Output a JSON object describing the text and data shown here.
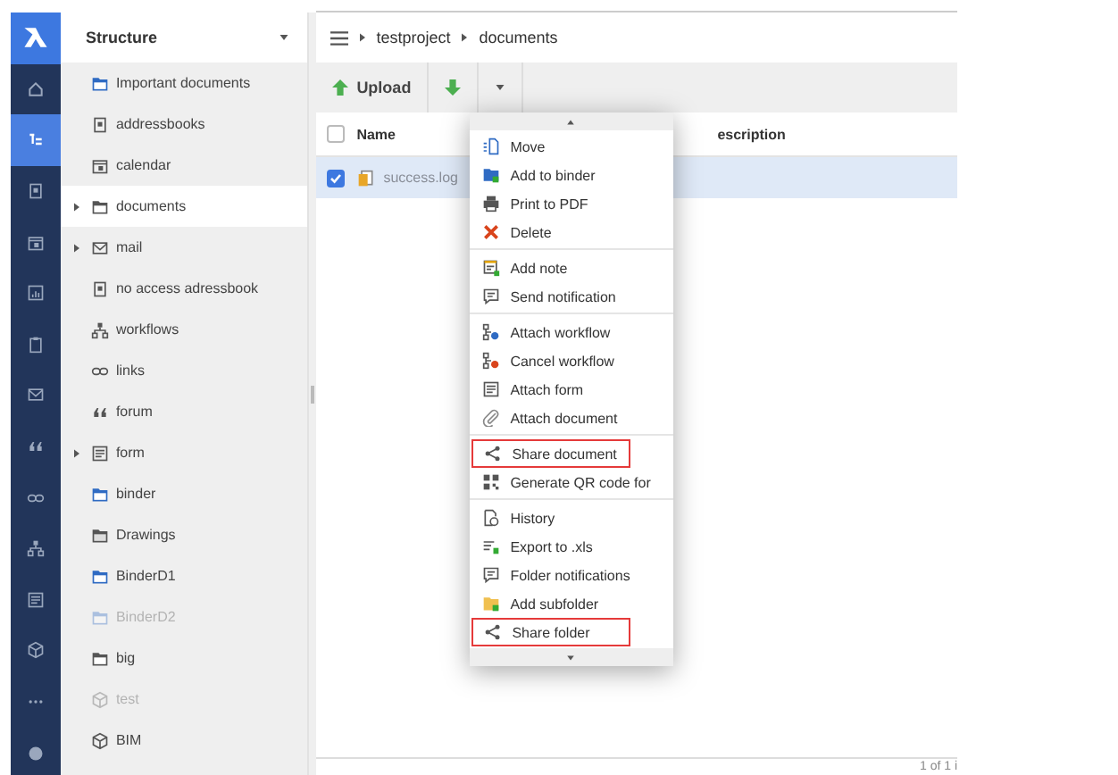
{
  "rail": [
    {
      "kind": "logo",
      "selected": false
    },
    {
      "kind": "home",
      "selected": false
    },
    {
      "kind": "tree",
      "selected": true
    },
    {
      "kind": "addressbook",
      "selected": false
    },
    {
      "kind": "calendar",
      "selected": false
    },
    {
      "kind": "chart",
      "selected": false
    },
    {
      "kind": "clipboard",
      "selected": false
    },
    {
      "kind": "mail",
      "selected": false
    },
    {
      "kind": "quote",
      "selected": false
    },
    {
      "kind": "link",
      "selected": false
    },
    {
      "kind": "workflow",
      "selected": false
    },
    {
      "kind": "form",
      "selected": false
    },
    {
      "kind": "cube",
      "selected": false
    },
    {
      "kind": "more",
      "selected": false
    },
    {
      "kind": "circle",
      "selected": false
    }
  ],
  "sidebar": {
    "title": "Structure",
    "items": [
      {
        "label": "Important documents",
        "kind": "folder-blue",
        "expandable": false,
        "selected": false,
        "disabled": false
      },
      {
        "label": "addressbooks",
        "kind": "addressbook",
        "expandable": false,
        "selected": false,
        "disabled": false
      },
      {
        "label": "calendar",
        "kind": "calendar",
        "expandable": false,
        "selected": false,
        "disabled": false
      },
      {
        "label": "documents",
        "kind": "folder",
        "expandable": true,
        "selected": true,
        "disabled": false
      },
      {
        "label": "mail",
        "kind": "mail",
        "expandable": true,
        "selected": false,
        "disabled": false
      },
      {
        "label": "no access adressbook",
        "kind": "addressbook",
        "expandable": false,
        "selected": false,
        "disabled": false
      },
      {
        "label": "workflows",
        "kind": "workflow",
        "expandable": false,
        "selected": false,
        "disabled": false
      },
      {
        "label": "links",
        "kind": "link",
        "expandable": false,
        "selected": false,
        "disabled": false
      },
      {
        "label": "forum",
        "kind": "quote",
        "expandable": false,
        "selected": false,
        "disabled": false
      },
      {
        "label": "form",
        "kind": "form",
        "expandable": true,
        "selected": false,
        "disabled": false
      },
      {
        "label": "binder",
        "kind": "folder-blue",
        "expandable": false,
        "selected": false,
        "disabled": false
      },
      {
        "label": "Drawings",
        "kind": "drawings",
        "expandable": false,
        "selected": false,
        "disabled": false
      },
      {
        "label": "BinderD1",
        "kind": "folder-blue",
        "expandable": false,
        "selected": false,
        "disabled": false
      },
      {
        "label": "BinderD2",
        "kind": "folder-blue",
        "expandable": false,
        "selected": false,
        "disabled": true
      },
      {
        "label": "big",
        "kind": "folder",
        "expandable": false,
        "selected": false,
        "disabled": false
      },
      {
        "label": "test",
        "kind": "cube",
        "expandable": false,
        "selected": false,
        "disabled": true
      },
      {
        "label": "BIM",
        "kind": "cube",
        "expandable": false,
        "selected": false,
        "disabled": false
      }
    ]
  },
  "breadcrumb": [
    "testproject",
    "documents"
  ],
  "toolbar": {
    "upload": "Upload"
  },
  "table": {
    "columns": [
      {
        "label": "Name"
      },
      {
        "label": "escription"
      }
    ],
    "header_checked": false,
    "rows": [
      {
        "name": "success.log",
        "checked": true,
        "selected": true
      }
    ]
  },
  "footer": "1 of 1 i",
  "menu": {
    "groups": [
      [
        {
          "label": "Move",
          "kind": "move",
          "highlighted": false
        },
        {
          "label": "Add to binder",
          "kind": "binder-add",
          "highlighted": false
        },
        {
          "label": "Print to PDF",
          "kind": "print",
          "highlighted": false
        },
        {
          "label": "Delete",
          "kind": "delete",
          "highlighted": false
        }
      ],
      [
        {
          "label": "Add note",
          "kind": "note",
          "highlighted": false
        },
        {
          "label": "Send notification",
          "kind": "notify",
          "highlighted": false
        }
      ],
      [
        {
          "label": "Attach workflow",
          "kind": "workflow-add",
          "highlighted": false
        },
        {
          "label": "Cancel workflow",
          "kind": "workflow-cancel",
          "highlighted": false
        },
        {
          "label": "Attach form",
          "kind": "form",
          "highlighted": false
        },
        {
          "label": "Attach document",
          "kind": "clip",
          "highlighted": false
        }
      ],
      [
        {
          "label": "Share document",
          "kind": "share",
          "highlighted": true
        },
        {
          "label": "Generate QR code for",
          "kind": "qr",
          "highlighted": false
        }
      ],
      [
        {
          "label": "History",
          "kind": "history",
          "highlighted": false
        },
        {
          "label": "Export to .xls",
          "kind": "export",
          "highlighted": false
        },
        {
          "label": "Folder notifications",
          "kind": "notify",
          "highlighted": false
        },
        {
          "label": "Add subfolder",
          "kind": "subfolder",
          "highlighted": false
        },
        {
          "label": "Share folder",
          "kind": "share",
          "highlighted": true
        }
      ]
    ]
  }
}
